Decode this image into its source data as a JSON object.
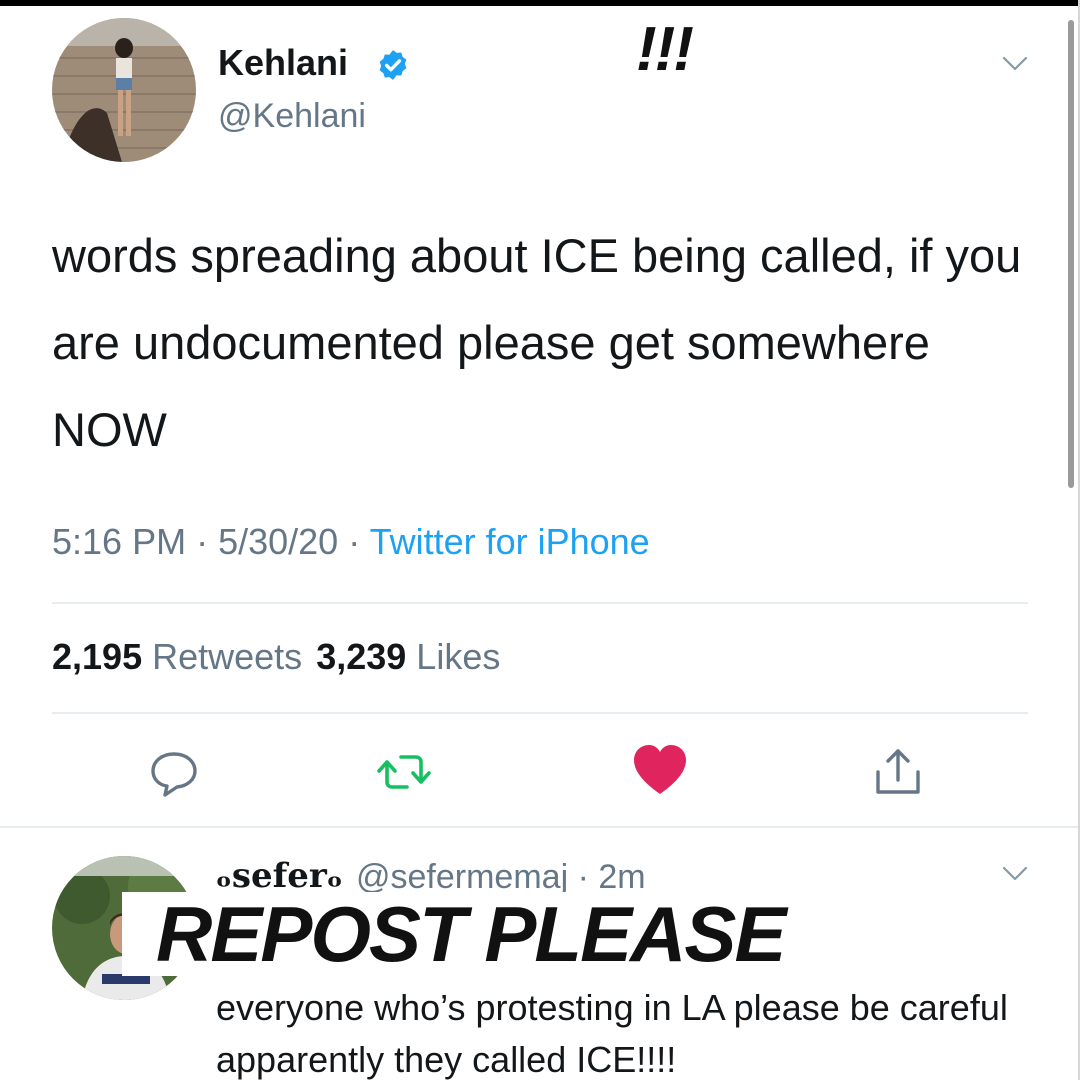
{
  "overlay_exclaim": "!!!",
  "tweet": {
    "author_name": "Kehlani",
    "author_handle": "@Kehlani",
    "verified": true,
    "text": "words spreading about ICE being called, if you are undocumented please get somewhere NOW",
    "time": "5:16 PM",
    "date": "5/30/20",
    "source": "Twitter for iPhone",
    "retweets_count": "2,195",
    "retweets_label": "Retweets",
    "likes_count": "3,239",
    "likes_label": "Likes",
    "liked": true
  },
  "reply": {
    "author_name": "ₒseferₒ",
    "author_handle": "@sefermemaj",
    "age": "2m",
    "text": "everyone who’s protesting in LA please be careful apparently they called ICE!!!!"
  },
  "overlay_banner": "REPOST PLEASE",
  "icons": {
    "verified": "verified-badge-icon",
    "menu": "chevron-down-icon",
    "reply": "reply-icon",
    "retweet": "retweet-icon",
    "like": "heart-icon",
    "share": "share-icon"
  },
  "colors": {
    "text": "#14171a",
    "secondary": "#657786",
    "link": "#1da1f2",
    "retweet": "#17bf63",
    "like": "#e0245e"
  }
}
